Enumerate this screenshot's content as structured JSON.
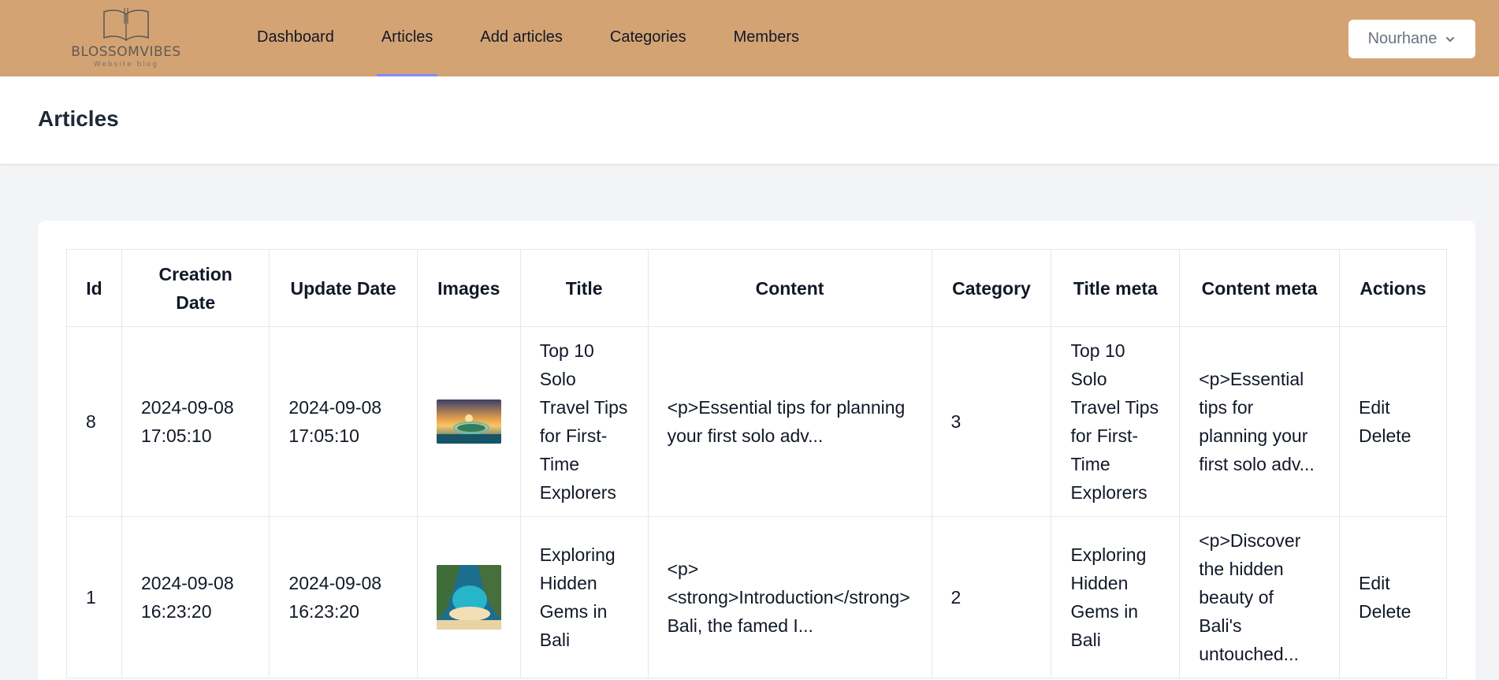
{
  "brand": {
    "name": "BLOSSOMVIBES",
    "subtitle": "Website blog"
  },
  "nav": {
    "items": [
      {
        "label": "Dashboard"
      },
      {
        "label": "Articles"
      },
      {
        "label": "Add articles"
      },
      {
        "label": "Categories"
      },
      {
        "label": "Members"
      }
    ],
    "active": "Articles"
  },
  "user": {
    "name": "Nourhane"
  },
  "page": {
    "title": "Articles"
  },
  "table": {
    "headers": [
      "Id",
      "Creation Date",
      "Update Date",
      "Images",
      "Title",
      "Content",
      "Category",
      "Title meta",
      "Content meta",
      "Actions"
    ],
    "rows": [
      {
        "id": "8",
        "creation_date": "2024-09-08 17:05:10",
        "update_date": "2024-09-08 17:05:10",
        "image": "sunset-island-thumbnail",
        "title": "Top 10 Solo Travel Tips for First-Time Explorers",
        "content": "<p>Essential tips for planning your first solo adv...",
        "category": "3",
        "title_meta": "Top 10 Solo Travel Tips for First-Time Explorers",
        "content_meta": "<p>Essential tips for planning your first solo adv...",
        "edit": "Edit",
        "delete": "Delete"
      },
      {
        "id": "1",
        "creation_date": "2024-09-08 16:23:20",
        "update_date": "2024-09-08 16:23:20",
        "image": "bali-beach-thumbnail",
        "title": "Exploring Hidden Gems in Bali",
        "content": "<p><strong>Introduction</strong> Bali, the famed I...",
        "category": "2",
        "title_meta": "Exploring Hidden Gems in Bali",
        "content_meta": "<p>Discover the hidden beauty of Bali's untouched...",
        "edit": "Edit",
        "delete": "Delete"
      }
    ]
  },
  "colors": {
    "navbar": "#d4a373",
    "active_tab_indicator": "#818cf8",
    "page_background": "#f3f4f6"
  },
  "icons": {
    "user_menu": "chevron-down-icon",
    "logo": "open-book-icon"
  }
}
